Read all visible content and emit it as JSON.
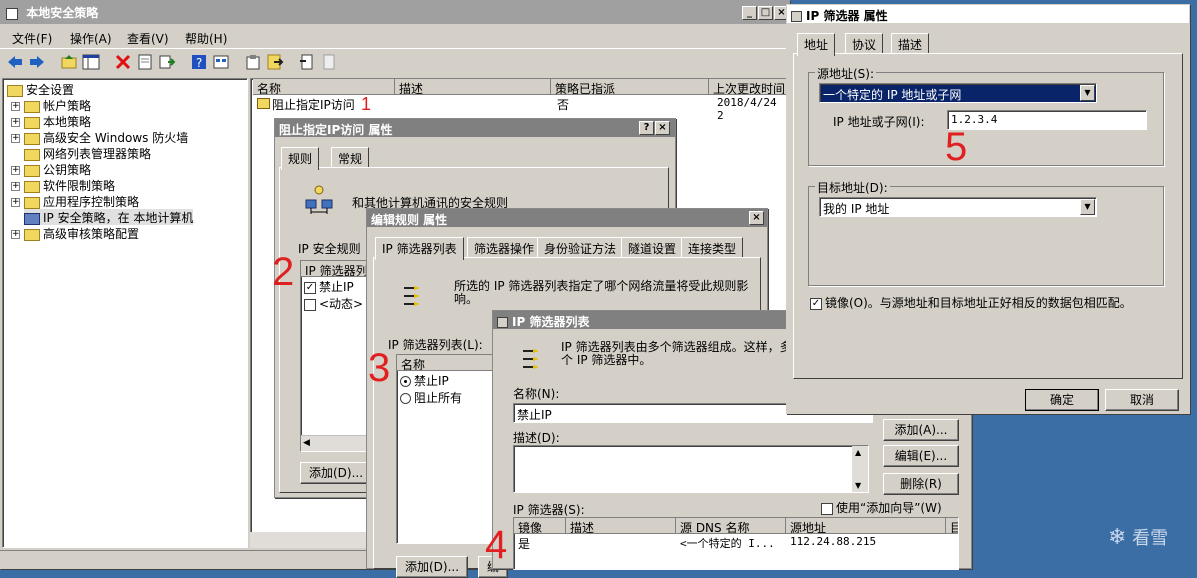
{
  "main_window": {
    "title": "本地安全策略",
    "menu": [
      "文件(F)",
      "操作(A)",
      "查看(V)",
      "帮助(H)"
    ]
  },
  "tree": {
    "root": "安全设置",
    "items": [
      "帐户策略",
      "本地策略",
      "高级安全 Windows 防火墙",
      "网络列表管理器策略",
      "公钥策略",
      "软件限制策略",
      "应用程序控制策略",
      "IP 安全策略，在 本地计算机",
      "高级审核策略配置"
    ]
  },
  "policy_list": {
    "columns": [
      "名称",
      "描述",
      "策略已指派",
      "上次更改时间"
    ],
    "rows": [
      {
        "name": "阻止指定IP访问",
        "desc": "",
        "assigned": "否",
        "changed": "2018/4/24 2"
      }
    ]
  },
  "annotations": {
    "n1": "1",
    "n2": "2",
    "n3": "3",
    "n4": "4",
    "n5": "5"
  },
  "props_dialog": {
    "title": "阻止指定IP访问 属性",
    "tabs": [
      "规则",
      "常规"
    ],
    "desc": "和其他计算机通讯的安全规则",
    "rules_label": "IP 安全规则",
    "list_header": "IP 筛选器列",
    "rows": [
      "禁止IP",
      "<动态>"
    ],
    "add": "添加(D)..."
  },
  "edit_rule": {
    "title": "编辑规则 属性",
    "tabs": [
      "IP 筛选器列表",
      "筛选器操作",
      "身份验证方法",
      "隧道设置",
      "连接类型"
    ],
    "desc": "所选的 IP 筛选器列表指定了哪个网络流量将受此规则影响。",
    "list_label": "IP 筛选器列表(L):",
    "col": "名称",
    "rows": [
      "禁止IP",
      "阻止所有"
    ],
    "add": "添加(D)...",
    "edit": "编"
  },
  "filter_list": {
    "title": "IP 筛选器列表",
    "desc": "IP 筛选器列表由多个筛选器组成。这样，多合到一个 IP 筛选器中。",
    "name_label": "名称(N):",
    "name_value": "禁止IP",
    "desc_label": "描述(D):",
    "filters_label": "IP 筛选器(S):",
    "wizard_label": "使用“添加向导”(W)",
    "columns": [
      "镜像",
      "描述",
      "源 DNS 名称",
      "源地址",
      "目"
    ],
    "row": {
      "mirror": "是",
      "desc": "",
      "src_dns": "<一个特定的 I...",
      "src_addr": "112.24.88.215"
    },
    "add": "添加(A)...",
    "edit": "编辑(E)...",
    "delete": "删除(R)"
  },
  "filter_props": {
    "title": "IP 筛选器 属性",
    "tabs": [
      "地址",
      "协议",
      "描述"
    ],
    "source_label": "源地址(S):",
    "source_value": "一个特定的 IP 地址或子网",
    "ip_label": "IP 地址或子网(I):",
    "ip_value": "1.2.3.4",
    "dest_label": "目标地址(D):",
    "dest_value": "我的 IP 地址",
    "mirror_label": "镜像(O)。与源地址和目标地址正好相反的数据包相匹配。",
    "ok": "确定",
    "cancel": "取消"
  },
  "watermark": "看雪"
}
